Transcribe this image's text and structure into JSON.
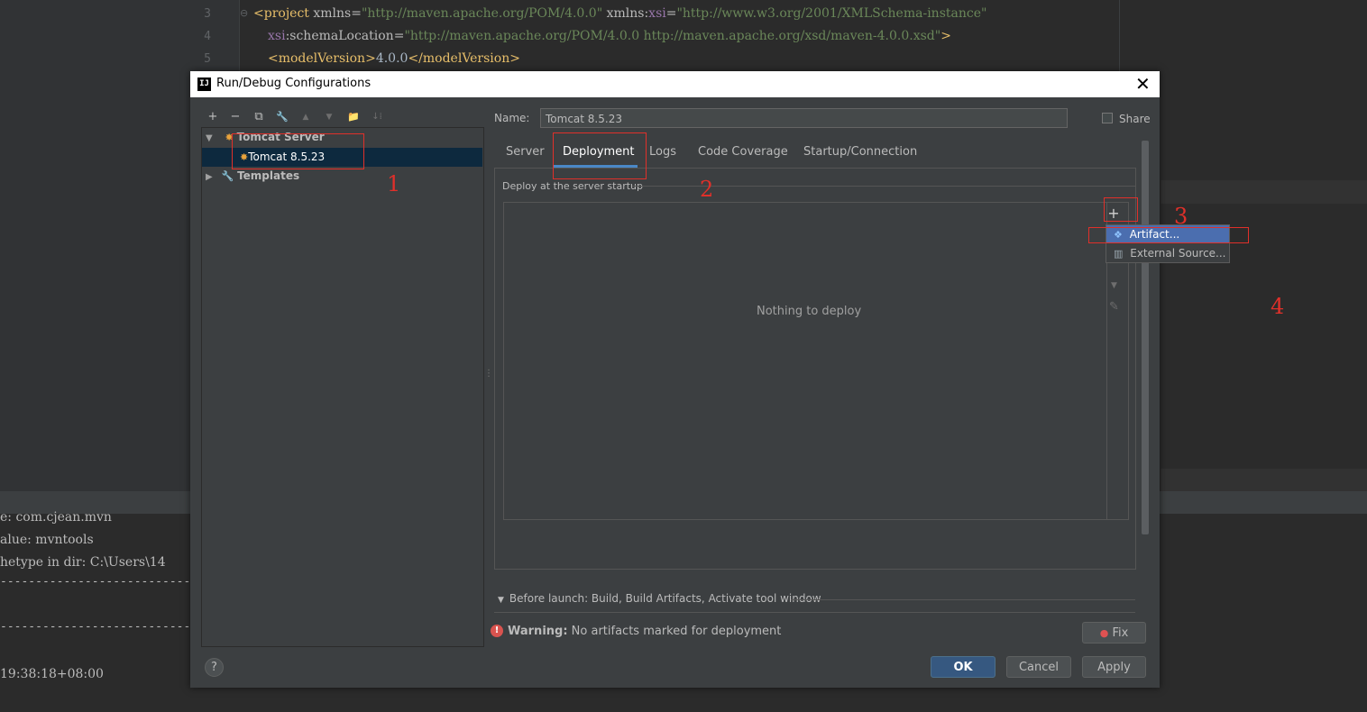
{
  "editor": {
    "lines": [
      {
        "no": "3",
        "parts": {
          "open": "<",
          "tag": "project",
          "a1": " xmlns",
          "eq1": "=",
          "v1": "\"http://maven.apache.org/POM/4.0.0\"",
          "ns": " xmlns",
          "colon": ":",
          "nsn": "xsi",
          "eq2": "=",
          "v2": "\"http://www.w3.org/2001/XMLSchema-instance\""
        }
      },
      {
        "no": "4",
        "parts": {
          "nsn": "xsi",
          "colon": ":",
          "attr": "schemaLocation",
          "eq": "=",
          "val": "\"http://maven.apache.org/POM/4.0.0 http://maven.apache.org/xsd/maven-4.0.0.xsd\"",
          "close": ">"
        }
      },
      {
        "no": "5",
        "parts": {
          "otag": "<modelVersion>",
          "text": "4.0.0",
          "ctag": "</modelVersion>"
        }
      }
    ]
  },
  "console": {
    "lines": [
      "e: com.cjean.mvn",
      "alue: mvntools",
      "hetype in dir: C:\\Users\\14",
      "------------------------------",
      "",
      "------------------------------",
      "",
      "19:38:18+08:00"
    ]
  },
  "dialog": {
    "title": "Run/Debug Configurations",
    "app_icon": "IJ",
    "toolbar": {
      "add": "+",
      "remove": "−",
      "copy": "⧉",
      "wrench": "🔧",
      "up": "▲",
      "down": "▼",
      "folder": "📁",
      "sort": "↓⁞"
    },
    "tree": {
      "group": "Tomcat Server",
      "child": "Tomcat 8.5.23",
      "templates": "Templates"
    },
    "name_label": "Name:",
    "name_value": "Tomcat 8.5.23",
    "share_label": "Share",
    "tabs": [
      "Server",
      "Deployment",
      "Logs",
      "Code Coverage",
      "Startup/Connection"
    ],
    "active_tab": "Deployment",
    "deploy_legend": "Deploy at the server startup",
    "empty_text": "Nothing to deploy",
    "add_symbol": "+",
    "popup": {
      "item1": "Artifact...",
      "item2": "External Source..."
    },
    "before_launch": "Before launch: Build, Build Artifacts, Activate tool window",
    "warning_bold": "Warning:",
    "warning_text": "No artifacts marked for deployment",
    "fix": "Fix",
    "ok": "OK",
    "cancel": "Cancel",
    "apply": "Apply",
    "help": "?"
  },
  "annotations": [
    "1",
    "2",
    "3",
    "4"
  ],
  "colors": {
    "accent": "#4a88c7",
    "selection": "#0d293e",
    "popup_selection": "#4b6eaf",
    "annotation": "#e0302a",
    "warning": "#d9534f"
  }
}
